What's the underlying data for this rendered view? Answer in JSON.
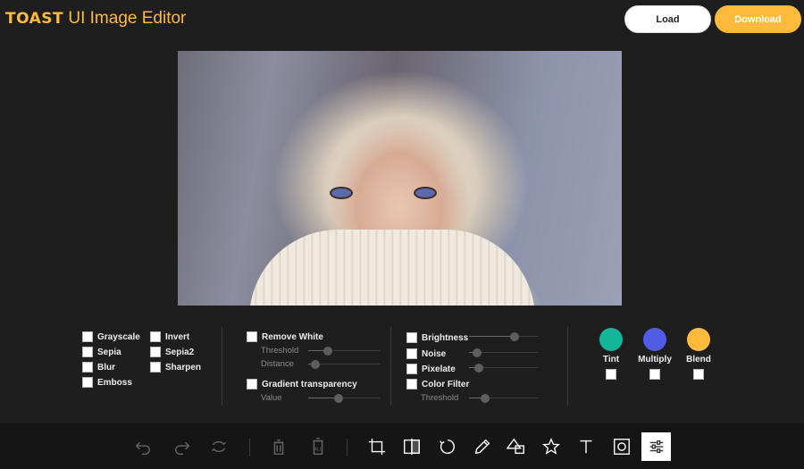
{
  "header": {
    "logo_brand": "TOAST",
    "logo_rest": " UI Image Editor",
    "load_label": "Load",
    "download_label": "Download"
  },
  "filters": {
    "basic": [
      "Grayscale",
      "Sepia",
      "Blur",
      "Emboss",
      "Invert",
      "Sepia2",
      "Sharpen"
    ],
    "remove_white": {
      "label": "Remove White",
      "threshold_label": "Threshold",
      "distance_label": "Distance"
    },
    "gradient_transparency": {
      "label": "Gradient transparency",
      "value_label": "Value"
    },
    "brightness": "Brightness",
    "noise": "Noise",
    "pixelate": "Pixelate",
    "color_filter": {
      "label": "Color Filter",
      "threshold_label": "Threshold"
    },
    "blend_modes": [
      {
        "label": "Tint",
        "color": "#14b69b"
      },
      {
        "label": "Multiply",
        "color": "#515ce6"
      },
      {
        "label": "Blend",
        "color": "#fdba3b"
      }
    ]
  },
  "colors": {
    "accent": "#fdba3b",
    "background": "#1e1e1e",
    "toolbar": "#151515"
  },
  "toolbar": {
    "icons": [
      "undo-icon",
      "redo-icon",
      "reset-icon",
      "delete-icon",
      "delete-all-icon",
      "crop-icon",
      "flip-icon",
      "rotate-icon",
      "draw-icon",
      "shape-icon",
      "icon-icon",
      "text-icon",
      "mask-icon",
      "filter-icon"
    ],
    "active": "filter-icon",
    "delete_all_text": "ALL"
  }
}
